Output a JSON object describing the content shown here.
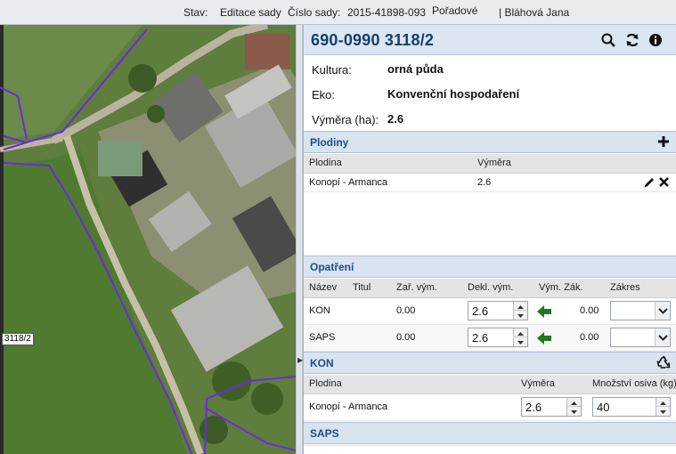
{
  "topbar": {
    "stav_label": "Stav:",
    "stav_value": "Editace sady",
    "cislo_label": "Číslo sady:",
    "cislo_value": "2015-41898-093",
    "poradove": "Pořadové",
    "user": "| Bláhová Jana"
  },
  "map": {
    "parcel_label": "3118/2"
  },
  "panel": {
    "title": "690-0990 3118/2",
    "icons": [
      "search-icon",
      "refresh-icon",
      "info-icon"
    ],
    "kultura_label": "Kultura:",
    "kultura_value": "orná půda",
    "eko_label": "Eko:",
    "eko_value": "Konvenční hospodaření",
    "vymera_label": "Výměra (ha):",
    "vymera_value": "2.6"
  },
  "plodiny": {
    "title": "Plodiny",
    "col_plodina": "Plodina",
    "col_vymera": "Výměra",
    "rows": [
      {
        "plodina": "Konopí - Armanca",
        "vymera": "2.6"
      }
    ]
  },
  "opatreni": {
    "title": "Opatření",
    "col_nazev": "Název",
    "col_titul": "Titul",
    "col_zar": "Zař. vým.",
    "col_dekl": "Dekl. vým.",
    "col_vymzak": "Vým. Zák.",
    "col_zakres": "Zákres",
    "rows": [
      {
        "nazev": "KON",
        "zar": "0.00",
        "dekl": "2.6",
        "vymzak": "0.00",
        "zakres": ""
      },
      {
        "nazev": "SAPS",
        "zar": "0.00",
        "dekl": "2.6",
        "vymzak": "0.00",
        "zakres": ""
      }
    ]
  },
  "kon": {
    "title": "KON",
    "col_plodina": "Plodina",
    "col_vymera": "Výměra",
    "col_osiva": "Množství osiva (kg)",
    "rows": [
      {
        "plodina": "Konopí - Armanca",
        "vymera": "2.6",
        "osiva": "40"
      }
    ]
  },
  "saps": {
    "title": "SAPS"
  },
  "colors": {
    "accent": "#15406e",
    "section_bg": "#d9e4f1",
    "arrow_green": "#1f7a1f",
    "parcel_border": "#6a2be0"
  }
}
